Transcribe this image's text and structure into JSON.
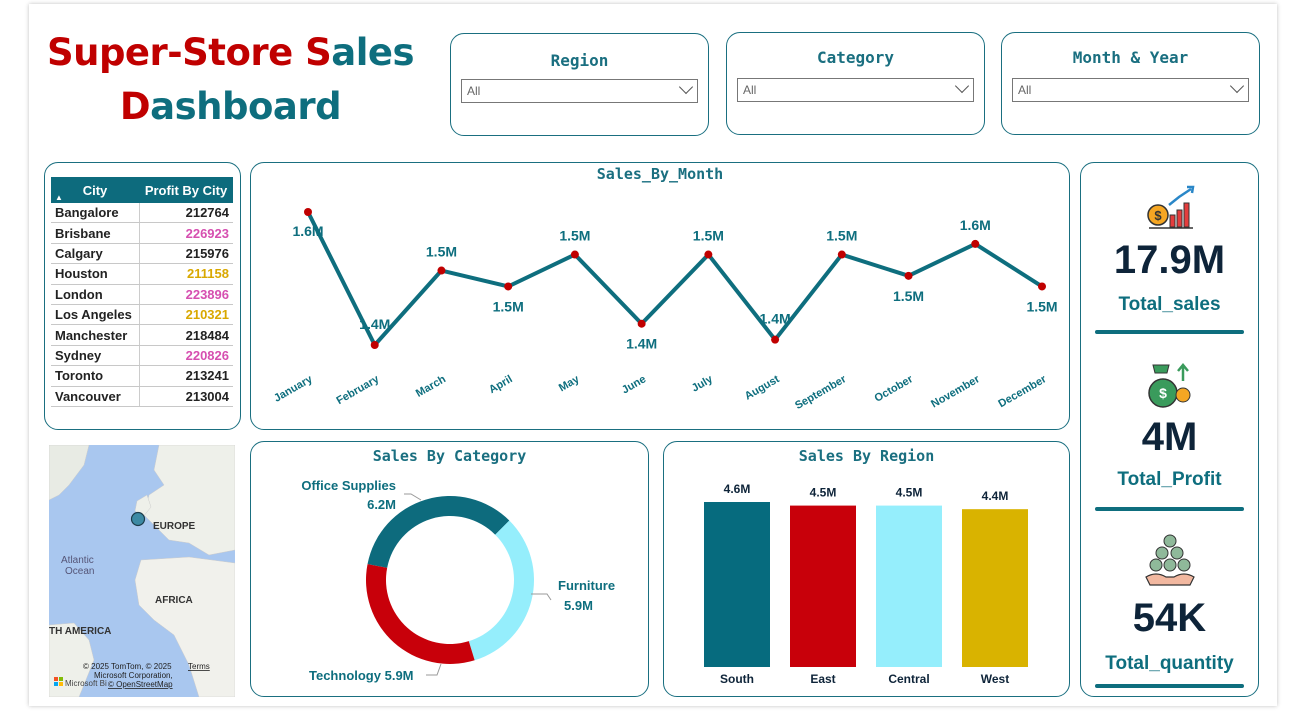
{
  "dashboard": {
    "title_parts": [
      "Super-Store ",
      "S",
      "ales",
      "D",
      "ashboard"
    ]
  },
  "slicers": [
    {
      "label": "Region",
      "value": "All"
    },
    {
      "label": "Category",
      "value": "All"
    },
    {
      "label": "Month & Year",
      "value": "All"
    }
  ],
  "city_table": {
    "headers": [
      "City",
      "Profit By City"
    ],
    "rows": [
      {
        "city": "Bangalore",
        "profit": "212764",
        "color": "#222222"
      },
      {
        "city": "Brisbane",
        "profit": "226923",
        "color": "#d64fb0"
      },
      {
        "city": "Calgary",
        "profit": "215976",
        "color": "#222222"
      },
      {
        "city": "Houston",
        "profit": "211158",
        "color": "#d9a800"
      },
      {
        "city": "London",
        "profit": "223896",
        "color": "#d64fb0"
      },
      {
        "city": "Los Angeles",
        "profit": "210321",
        "color": "#d9a800"
      },
      {
        "city": "Manchester",
        "profit": "218484",
        "color": "#222222"
      },
      {
        "city": "Sydney",
        "profit": "220826",
        "color": "#d64fb0"
      },
      {
        "city": "Toronto",
        "profit": "213241",
        "color": "#222222"
      },
      {
        "city": "Vancouver",
        "profit": "213004",
        "color": "#222222"
      }
    ]
  },
  "map": {
    "labels": [
      "EUROPE",
      "Atlantic",
      "Ocean",
      "AFRICA",
      "TH AMERICA"
    ],
    "attribution": [
      "© 2025 TomTom, © 2025",
      "Microsoft Corporation,",
      "© OpenStreetMap",
      "Terms",
      "Microsoft Bi"
    ]
  },
  "kpis": [
    {
      "value": "17.9M",
      "label": "Total_sales",
      "icon": "sales-chart-icon"
    },
    {
      "value": "4M",
      "label": "Total_Profit",
      "icon": "money-bag-icon"
    },
    {
      "value": "54K",
      "label": "Total_quantity",
      "icon": "coins-hand-icon"
    }
  ],
  "chart_data": [
    {
      "type": "line",
      "title": "Sales_By_Month",
      "categories": [
        "January",
        "February",
        "March",
        "April",
        "May",
        "June",
        "July",
        "August",
        "September",
        "October",
        "November",
        "December"
      ],
      "values": [
        1.63,
        1.38,
        1.52,
        1.49,
        1.55,
        1.42,
        1.55,
        1.39,
        1.55,
        1.51,
        1.57,
        1.49
      ],
      "data_labels": [
        "1.6M",
        "1.4M",
        "1.5M",
        "1.5M",
        "1.5M",
        "1.4M",
        "1.5M",
        "1.4M",
        "1.5M",
        "1.5M",
        "1.6M",
        "1.5M"
      ],
      "line_color": "#0e6e7e",
      "marker_color": "#c00000"
    },
    {
      "type": "pie",
      "title": "Sales By Category",
      "categories": [
        "Office Supplies",
        "Furniture",
        "Technology"
      ],
      "values": [
        6.2,
        5.9,
        5.9
      ],
      "data_labels": [
        "6.2M",
        "5.9M",
        "5.9M"
      ],
      "colors": [
        "#0d6b7d",
        "#95eefc",
        "#c8000a"
      ]
    },
    {
      "type": "bar",
      "title": "Sales By Region",
      "categories": [
        "South",
        "East",
        "Central",
        "West"
      ],
      "values": [
        4.6,
        4.5,
        4.5,
        4.4
      ],
      "data_labels": [
        "4.6M",
        "4.5M",
        "4.5M",
        "4.4M"
      ],
      "colors": [
        "#066b7e",
        "#c8000a",
        "#95eefc",
        "#d9b300"
      ]
    }
  ]
}
